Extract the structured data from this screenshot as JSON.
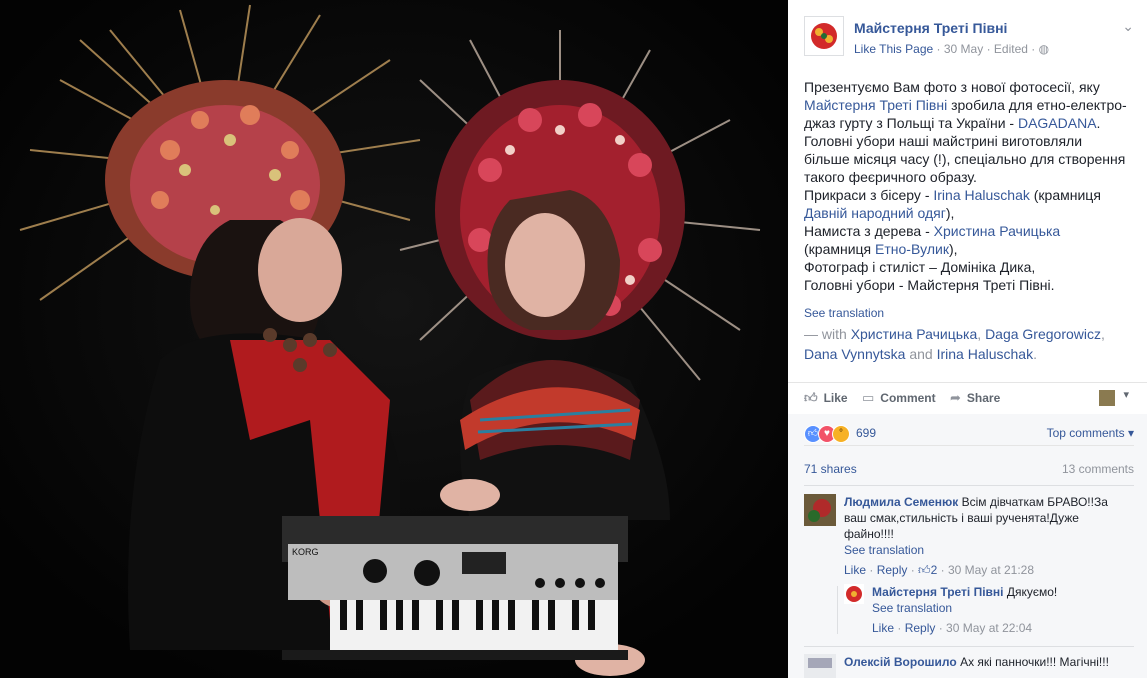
{
  "photo": {
    "alt": "",
    "keyboard_brand": "KORG"
  },
  "post": {
    "page_name": "Майстерня Треті Півні",
    "like_page": "Like This Page",
    "date": "30 May",
    "edited": "Edited",
    "privacy_icon": "globe-icon",
    "menu_icon": "chevron-down-icon",
    "text": {
      "l1": "Презентуємо Вам фото з нової фотосесії, яку",
      "l2_link": "Майстерня Треті Півні",
      "l2_rest": " зробила для етно-електро-",
      "l3a": "джаз гурту з Польщі та України - ",
      "l3_link": "DAGADANA",
      "l3b": ".",
      "l4": "Головні убори наші майстрині виготовляли",
      "l5": "більше місяця часу (!), спеціально для створення",
      "l6": "такого феєричного образу.",
      "l7a": "Прикраси з бісеру - ",
      "l7_link": "Irina Haluschak",
      "l7b": " (крамниця",
      "l8_link": "Давній народний одяг",
      "l8b": "),",
      "l9a": "Намиста з дерева - ",
      "l9_link": "Христина Рачицька",
      "l10a": "(крамниця ",
      "l10_link": "Етно-Вулик",
      "l10b": "),",
      "l11": "Фотограф і стиліст – Домініка Дика,",
      "l12": "Головні убори - Майстерня Треті Півні."
    },
    "see_translation": "See translation",
    "with": {
      "prefix": " — with ",
      "p1": "Христина Рачицька",
      "c1": ", ",
      "p2": "Daga Gregorowicz",
      "c2": ",",
      "p3": "Dana Vynnytska",
      "and": " and ",
      "p4": "Irina Haluschak",
      "end": "."
    }
  },
  "actions": {
    "like": "Like",
    "comment": "Comment",
    "share": "Share"
  },
  "stats": {
    "reactions": "699",
    "top_comments": "Top comments",
    "shares": "71 shares",
    "comments": "13 comments"
  },
  "comments": [
    {
      "author": "Людмила Семенюк",
      "text_a": "Всім дівчаткам БРАВО!!За",
      "text_b": "ваш смак,стильність і ваші рученята!Дуже",
      "text_c": "файно!!!!",
      "see": "See translation",
      "like": "Like",
      "reply": "Reply",
      "likes": "2",
      "time": "30 May at 21:28"
    },
    {
      "author": "Майстерня Треті Півні",
      "text": "Дякуємо!",
      "see": "See translation",
      "like": "Like",
      "reply": "Reply",
      "time": "30 May at 22:04"
    },
    {
      "author": "Олексій Ворошило",
      "text": "Ах які панночки!!! Магічні!!!"
    }
  ],
  "colors": {
    "link": "#365899",
    "muted": "#90949c",
    "like_blue": "#5890ff",
    "love_red": "#f25268",
    "wow_yellow": "#f7b125"
  }
}
